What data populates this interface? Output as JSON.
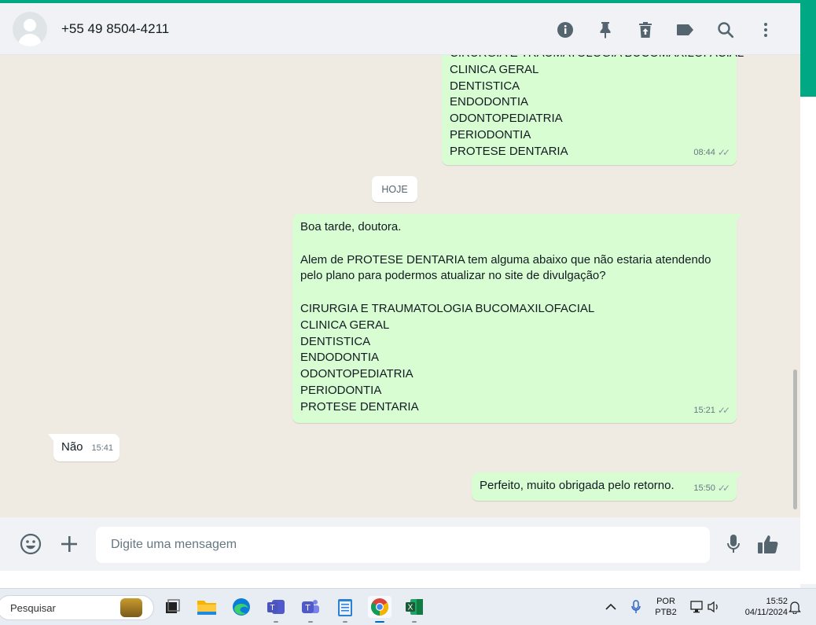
{
  "header": {
    "contact_name": "+55 49 8504-4211",
    "icons": [
      "info-icon",
      "pin-icon",
      "delete-icon",
      "label-icon",
      "search-icon",
      "more-options-icon"
    ]
  },
  "chat": {
    "day_chip": "HOJE",
    "messages": [
      {
        "direction": "out",
        "lines": [
          "CIRURGIA E TRAUMATOLOGIA BUCOMAXILOFACIAL",
          "CLINICA GERAL",
          "DENTISTICA",
          "ENDODONTIA",
          "ODONTOPEDIATRIA",
          "PERIODONTIA",
          "PROTESE DENTARIA"
        ],
        "time": "08:44"
      },
      {
        "direction": "out",
        "lines": [
          "Boa tarde, doutora.",
          "",
          "Alem de PROTESE DENTARIA tem alguma abaixo que não estaria atendendo",
          "pelo plano para podermos atualizar no site de divulgação?",
          "",
          "CIRURGIA E TRAUMATOLOGIA BUCOMAXILOFACIAL",
          "CLINICA GERAL",
          "DENTISTICA",
          "ENDODONTIA",
          "ODONTOPEDIATRIA",
          "PERIODONTIA",
          "PROTESE DENTARIA"
        ],
        "time": "15:21"
      },
      {
        "direction": "in",
        "lines": [
          "Não"
        ],
        "time": "15:41"
      },
      {
        "direction": "out",
        "lines": [
          "Perfeito, muito obrigada pelo retorno."
        ],
        "time": "15:50"
      }
    ]
  },
  "composer": {
    "placeholder": "Digite uma mensagem"
  },
  "taskbar": {
    "search_label": "Pesquisar",
    "language": "POR",
    "layout": "PTB2",
    "time": "15:52",
    "date": "04/11/2024"
  },
  "colors": {
    "accent": "#00a884",
    "outgoing_bubble": "#d9fdd3",
    "incoming_bubble": "#ffffff",
    "chat_background": "#efeae2",
    "panel": "#f0f2f5"
  }
}
